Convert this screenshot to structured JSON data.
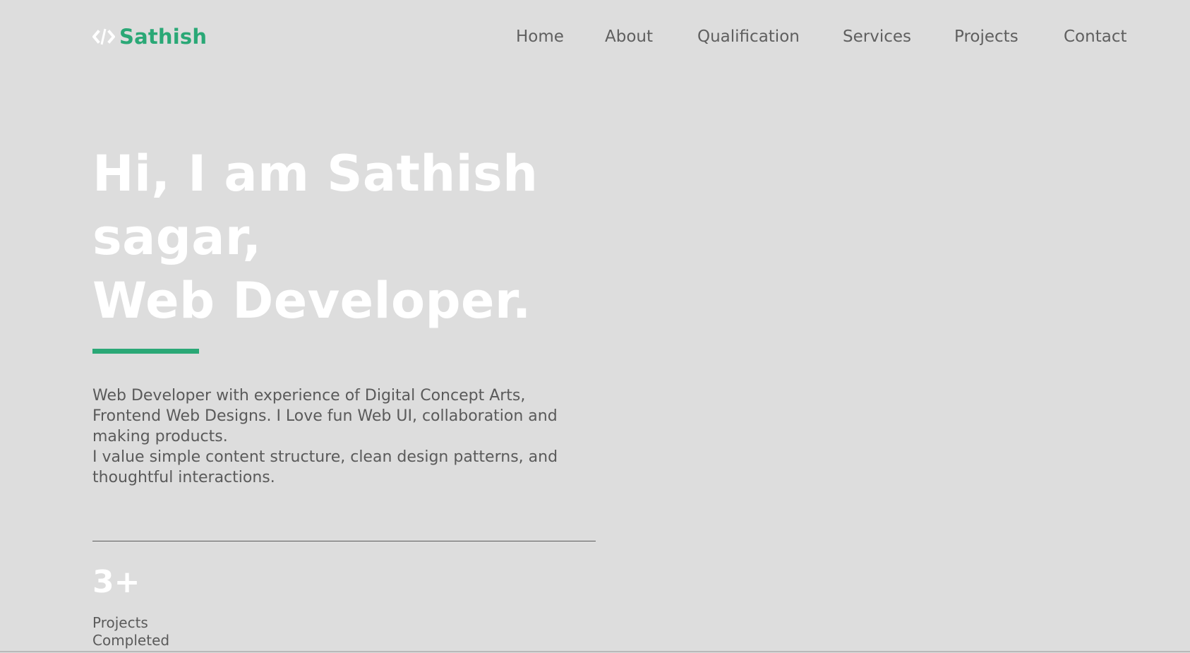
{
  "colors": {
    "background": "#dddddd",
    "accent": "#2aa876",
    "hero_text": "#ffffff",
    "body_text": "#5a5a5a"
  },
  "brand": {
    "icon": "code-icon",
    "name": "Sathish"
  },
  "nav": {
    "items": [
      {
        "label": "Home"
      },
      {
        "label": "About"
      },
      {
        "label": "Qualification"
      },
      {
        "label": "Services"
      },
      {
        "label": "Projects"
      },
      {
        "label": "Contact"
      }
    ]
  },
  "hero": {
    "title_lines": [
      "Hi, I am Sathish",
      "sagar,",
      "Web Developer."
    ],
    "description_lines": [
      "Web Developer with experience of Digital Concept Arts,",
      "Frontend Web Designs. I Love fun Web UI, collaboration and",
      "making products.",
      "I value simple content structure, clean design patterns, and",
      "thoughtful interactions."
    ]
  },
  "stats": [
    {
      "value": "3+",
      "label_lines": [
        "Projects",
        "Completed"
      ]
    }
  ]
}
